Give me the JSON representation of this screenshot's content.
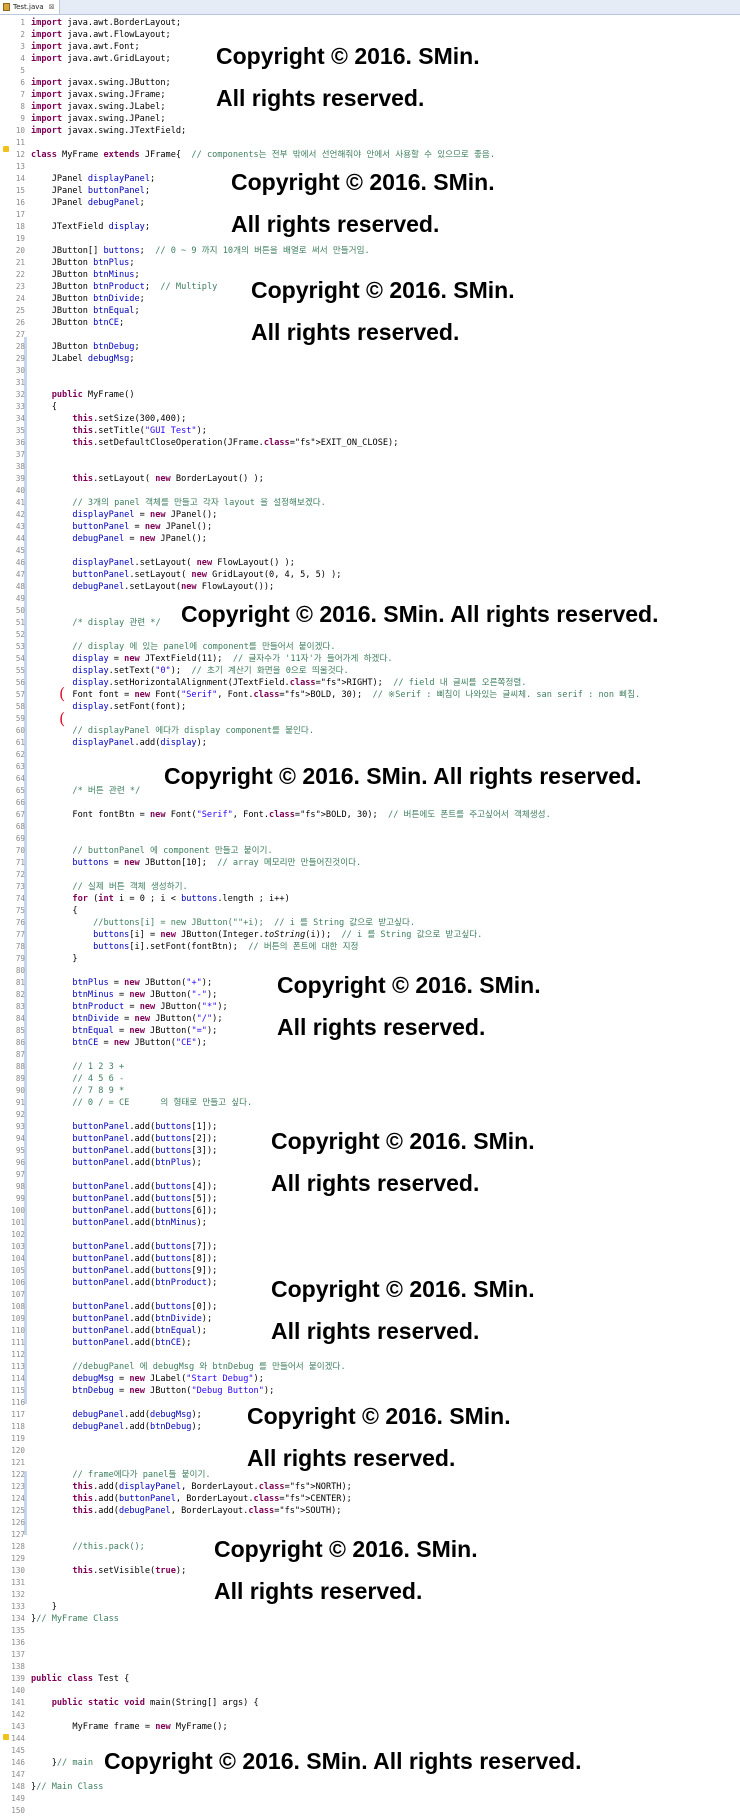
{
  "tab": {
    "title": "Test.java",
    "close_symbol": "⊠",
    "file_icon": "java-file-icon"
  },
  "watermarks": [
    "Copyright © 2016. SMin.",
    "All rights reserved.",
    "Copyright © 2016. SMin. All rights reserved."
  ],
  "annotations": {
    "paren_symbol": "("
  },
  "lines": [
    {
      "n": "1",
      "t": "import java.awt.BorderLayout;"
    },
    {
      "n": "2",
      "t": "import java.awt.FlowLayout;"
    },
    {
      "n": "3",
      "t": "import java.awt.Font;"
    },
    {
      "n": "4",
      "t": "import java.awt.GridLayout;"
    },
    {
      "n": "5",
      "t": ""
    },
    {
      "n": "6",
      "t": "import javax.swing.JButton;"
    },
    {
      "n": "7",
      "t": "import javax.swing.JFrame;"
    },
    {
      "n": "8",
      "t": "import javax.swing.JLabel;"
    },
    {
      "n": "9",
      "t": "import javax.swing.JPanel;"
    },
    {
      "n": "10",
      "t": "import javax.swing.JTextField;"
    },
    {
      "n": "11",
      "t": ""
    },
    {
      "n": "12",
      "t": "class MyFrame extends JFrame{  // components는 전부 밖에서 선언해줘야 안에서 사용할 수 있으므로 좋음."
    },
    {
      "n": "13",
      "t": ""
    },
    {
      "n": "14",
      "t": "    JPanel displayPanel;"
    },
    {
      "n": "15",
      "t": "    JPanel buttonPanel;"
    },
    {
      "n": "16",
      "t": "    JPanel debugPanel;"
    },
    {
      "n": "17",
      "t": ""
    },
    {
      "n": "18",
      "t": "    JTextField display;"
    },
    {
      "n": "19",
      "t": ""
    },
    {
      "n": "20",
      "t": "    JButton[] buttons;  // 0 ~ 9 까지 10개의 버튼을 배열로 써서 만들거임."
    },
    {
      "n": "21",
      "t": "    JButton btnPlus;"
    },
    {
      "n": "22",
      "t": "    JButton btnMinus;"
    },
    {
      "n": "23",
      "t": "    JButton btnProduct;  // Multiply"
    },
    {
      "n": "24",
      "t": "    JButton btnDivide;"
    },
    {
      "n": "25",
      "t": "    JButton btnEqual;"
    },
    {
      "n": "26",
      "t": "    JButton btnCE;"
    },
    {
      "n": "27",
      "t": ""
    },
    {
      "n": "28",
      "t": "    JButton btnDebug;"
    },
    {
      "n": "29",
      "t": "    JLabel debugMsg;"
    },
    {
      "n": "30",
      "t": ""
    },
    {
      "n": "31",
      "t": ""
    },
    {
      "n": "32",
      "t": "    public MyFrame()"
    },
    {
      "n": "33",
      "t": "    {"
    },
    {
      "n": "34",
      "t": "        this.setSize(300,400);"
    },
    {
      "n": "35",
      "t": "        this.setTitle(\"GUI Test\");"
    },
    {
      "n": "36",
      "t": "        this.setDefaultCloseOperation(JFrame.EXIT_ON_CLOSE);"
    },
    {
      "n": "37",
      "t": ""
    },
    {
      "n": "38",
      "t": ""
    },
    {
      "n": "39",
      "t": "        this.setLayout( new BorderLayout() );"
    },
    {
      "n": "40",
      "t": ""
    },
    {
      "n": "41",
      "t": "        // 3개의 panel 객체를 만들고 각자 layout 을 설정해보겠다."
    },
    {
      "n": "42",
      "t": "        displayPanel = new JPanel();"
    },
    {
      "n": "43",
      "t": "        buttonPanel = new JPanel();"
    },
    {
      "n": "44",
      "t": "        debugPanel = new JPanel();"
    },
    {
      "n": "45",
      "t": ""
    },
    {
      "n": "46",
      "t": "        displayPanel.setLayout( new FlowLayout() );"
    },
    {
      "n": "47",
      "t": "        buttonPanel.setLayout( new GridLayout(0, 4, 5, 5) );"
    },
    {
      "n": "48",
      "t": "        debugPanel.setLayout(new FlowLayout());"
    },
    {
      "n": "49",
      "t": ""
    },
    {
      "n": "50",
      "t": ""
    },
    {
      "n": "51",
      "t": "        /* display 관련 */"
    },
    {
      "n": "52",
      "t": ""
    },
    {
      "n": "53",
      "t": "        // display 에 있는 panel에 component를 만들어서 붙이겠다."
    },
    {
      "n": "54",
      "t": "        display = new JTextField(11);  // 글자수가 '11자'가 들어가게 하겠다."
    },
    {
      "n": "55",
      "t": "        display.setText(\"0\");  // 초기 계산기 화면을 0으로 띄울것다."
    },
    {
      "n": "56",
      "t": "        display.setHorizontalAlignment(JTextField.RIGHT);  // field 내 글씨를 오른쪽정렬."
    },
    {
      "n": "57",
      "t": "        Font font = new Font(\"Serif\", Font.BOLD, 30);  // ※Serif : 삐침이 나와있는 글씨체. san serif : non 삐침."
    },
    {
      "n": "58",
      "t": "        display.setFont(font);"
    },
    {
      "n": "59",
      "t": ""
    },
    {
      "n": "60",
      "t": "        // displayPanel 에다가 display component를 붙인다."
    },
    {
      "n": "61",
      "t": "        displayPanel.add(display);"
    },
    {
      "n": "62",
      "t": ""
    },
    {
      "n": "63",
      "t": ""
    },
    {
      "n": "64",
      "t": ""
    },
    {
      "n": "65",
      "t": "        /* 버튼 관련 */"
    },
    {
      "n": "66",
      "t": ""
    },
    {
      "n": "67",
      "t": "        Font fontBtn = new Font(\"Serif\", Font.BOLD, 30);  // 버튼에도 폰트를 주고싶어서 객체생성."
    },
    {
      "n": "68",
      "t": ""
    },
    {
      "n": "69",
      "t": ""
    },
    {
      "n": "70",
      "t": "        // buttonPanel 에 component 만들고 붙이기."
    },
    {
      "n": "71",
      "t": "        buttons = new JButton[10];  // array 메모리만 만들어진것이다."
    },
    {
      "n": "72",
      "t": ""
    },
    {
      "n": "73",
      "t": "        // 실제 버튼 객체 생성하기."
    },
    {
      "n": "74",
      "t": "        for (int i = 0 ; i < buttons.length ; i++)"
    },
    {
      "n": "75",
      "t": "        {"
    },
    {
      "n": "76",
      "t": "            //buttons[i] = new JButton(\"\"+i);  // i 를 String 값으로 받고싶다."
    },
    {
      "n": "77",
      "t": "            buttons[i] = new JButton(Integer.toString(i));  // i 를 String 값으로 받고싶다."
    },
    {
      "n": "78",
      "t": "            buttons[i].setFont(fontBtn);  // 버튼의 폰트에 대한 지정"
    },
    {
      "n": "79",
      "t": "        }"
    },
    {
      "n": "80",
      "t": ""
    },
    {
      "n": "81",
      "t": "        btnPlus = new JButton(\"+\");"
    },
    {
      "n": "82",
      "t": "        btnMinus = new JButton(\"-\");"
    },
    {
      "n": "83",
      "t": "        btnProduct = new JButton(\"*\");"
    },
    {
      "n": "84",
      "t": "        btnDivide = new JButton(\"/\");"
    },
    {
      "n": "85",
      "t": "        btnEqual = new JButton(\"=\");"
    },
    {
      "n": "86",
      "t": "        btnCE = new JButton(\"CE\");"
    },
    {
      "n": "87",
      "t": ""
    },
    {
      "n": "88",
      "t": "        // 1 2 3 +"
    },
    {
      "n": "89",
      "t": "        // 4 5 6 -"
    },
    {
      "n": "90",
      "t": "        // 7 8 9 *"
    },
    {
      "n": "91",
      "t": "        // 0 / = CE      의 형태로 만들고 싶다."
    },
    {
      "n": "92",
      "t": ""
    },
    {
      "n": "93",
      "t": "        buttonPanel.add(buttons[1]);"
    },
    {
      "n": "94",
      "t": "        buttonPanel.add(buttons[2]);"
    },
    {
      "n": "95",
      "t": "        buttonPanel.add(buttons[3]);"
    },
    {
      "n": "96",
      "t": "        buttonPanel.add(btnPlus);"
    },
    {
      "n": "97",
      "t": ""
    },
    {
      "n": "98",
      "t": "        buttonPanel.add(buttons[4]);"
    },
    {
      "n": "99",
      "t": "        buttonPanel.add(buttons[5]);"
    },
    {
      "n": "100",
      "t": "        buttonPanel.add(buttons[6]);"
    },
    {
      "n": "101",
      "t": "        buttonPanel.add(btnMinus);"
    },
    {
      "n": "102",
      "t": ""
    },
    {
      "n": "103",
      "t": "        buttonPanel.add(buttons[7]);"
    },
    {
      "n": "104",
      "t": "        buttonPanel.add(buttons[8]);"
    },
    {
      "n": "105",
      "t": "        buttonPanel.add(buttons[9]);"
    },
    {
      "n": "106",
      "t": "        buttonPanel.add(btnProduct);"
    },
    {
      "n": "107",
      "t": ""
    },
    {
      "n": "108",
      "t": "        buttonPanel.add(buttons[0]);"
    },
    {
      "n": "109",
      "t": "        buttonPanel.add(btnDivide);"
    },
    {
      "n": "110",
      "t": "        buttonPanel.add(btnEqual);"
    },
    {
      "n": "111",
      "t": "        buttonPanel.add(btnCE);"
    },
    {
      "n": "112",
      "t": ""
    },
    {
      "n": "113",
      "t": "        //debugPanel 에 debugMsg 와 btnDebug 를 만들어서 붙이겠다."
    },
    {
      "n": "114",
      "t": "        debugMsg = new JLabel(\"Start Debug\");"
    },
    {
      "n": "115",
      "t": "        btnDebug = new JButton(\"Debug Button\");"
    },
    {
      "n": "116",
      "t": ""
    },
    {
      "n": "117",
      "t": "        debugPanel.add(debugMsg);"
    },
    {
      "n": "118",
      "t": "        debugPanel.add(btnDebug);"
    },
    {
      "n": "119",
      "t": ""
    },
    {
      "n": "120",
      "t": ""
    },
    {
      "n": "121",
      "t": ""
    },
    {
      "n": "122",
      "t": "        // frame에다가 panel들 붙이기."
    },
    {
      "n": "123",
      "t": "        this.add(displayPanel, BorderLayout.NORTH);"
    },
    {
      "n": "124",
      "t": "        this.add(buttonPanel, BorderLayout.CENTER);"
    },
    {
      "n": "125",
      "t": "        this.add(debugPanel, BorderLayout.SOUTH);"
    },
    {
      "n": "126",
      "t": ""
    },
    {
      "n": "127",
      "t": ""
    },
    {
      "n": "128",
      "t": "        //this.pack();"
    },
    {
      "n": "129",
      "t": ""
    },
    {
      "n": "130",
      "t": "        this.setVisible(true);"
    },
    {
      "n": "131",
      "t": ""
    },
    {
      "n": "132",
      "t": ""
    },
    {
      "n": "133",
      "t": "    }"
    },
    {
      "n": "134",
      "t": "}// MyFrame Class"
    },
    {
      "n": "135",
      "t": ""
    },
    {
      "n": "136",
      "t": ""
    },
    {
      "n": "137",
      "t": ""
    },
    {
      "n": "138",
      "t": ""
    },
    {
      "n": "139",
      "t": "public class Test {"
    },
    {
      "n": "140",
      "t": ""
    },
    {
      "n": "141",
      "t": "    public static void main(String[] args) {"
    },
    {
      "n": "142",
      "t": ""
    },
    {
      "n": "143",
      "t": "        MyFrame frame = new MyFrame();"
    },
    {
      "n": "144",
      "t": ""
    },
    {
      "n": "145",
      "t": ""
    },
    {
      "n": "146",
      "t": "    }// main"
    },
    {
      "n": "147",
      "t": ""
    },
    {
      "n": "148",
      "t": "}// Main Class"
    },
    {
      "n": "149",
      "t": ""
    },
    {
      "n": "150",
      "t": ""
    }
  ]
}
